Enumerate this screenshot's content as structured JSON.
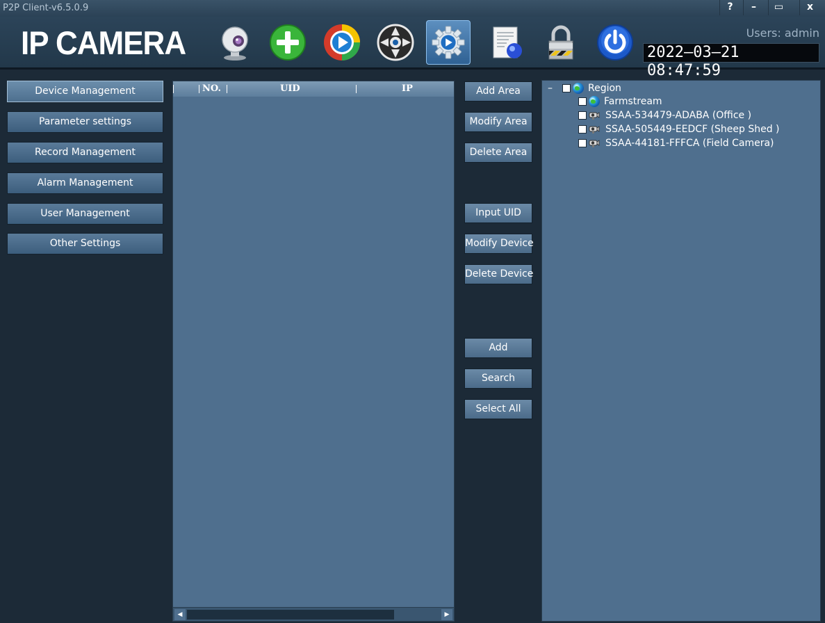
{
  "window": {
    "title": "P2P Client-v6.5.0.9",
    "help_label": "?",
    "minimize_label": "–",
    "maximize_label": "▭",
    "close_label": "x"
  },
  "header": {
    "logo": "IP CAMERA",
    "users": "Users: admin",
    "clock": "2022–03–21  08:47:59",
    "toolbar": [
      {
        "name": "live-view",
        "icon": "webcam-icon"
      },
      {
        "name": "add",
        "icon": "plus-icon"
      },
      {
        "name": "playback",
        "icon": "play-icon"
      },
      {
        "name": "ptz",
        "icon": "ptz-wheel-icon"
      },
      {
        "name": "settings",
        "icon": "gear-icon",
        "active": true
      },
      {
        "name": "log",
        "icon": "log-document-icon"
      },
      {
        "name": "lock",
        "icon": "lock-icon"
      },
      {
        "name": "exit",
        "icon": "power-icon"
      }
    ]
  },
  "sidebar": {
    "items": [
      {
        "label": "Device Management",
        "active": true
      },
      {
        "label": "Parameter settings"
      },
      {
        "label": "Record Management"
      },
      {
        "label": "Alarm Management"
      },
      {
        "label": "User Management"
      },
      {
        "label": "Other Settings"
      }
    ]
  },
  "device_list": {
    "columns": [
      "NO.",
      "UID",
      "IP"
    ],
    "rows": []
  },
  "actions": {
    "add_area": "Add Area",
    "modify_area": "Modify Area",
    "delete_area": "Delete Area",
    "input_uid": "Input UID",
    "modify_device": "Modify Device",
    "delete_device": "Delete Device",
    "add": "Add",
    "search": "Search",
    "select_all": "Select All"
  },
  "tree": {
    "expander": "–",
    "root": "Region",
    "children": [
      {
        "label": "Farmstream",
        "type": "area"
      },
      {
        "label": "SSAA-534479-ADABA  (Office )",
        "type": "camera"
      },
      {
        "label": "SSAA-505449-EEDCF  (Sheep Shed )",
        "type": "camera"
      },
      {
        "label": "SSAA-44181-FFFCA  (Field Camera)",
        "type": "camera"
      }
    ]
  },
  "colors": {
    "background": "#1c2a37",
    "panel": "#4f6f8e",
    "button": "#5a7b99",
    "accent_active": "#5d8fbf"
  }
}
